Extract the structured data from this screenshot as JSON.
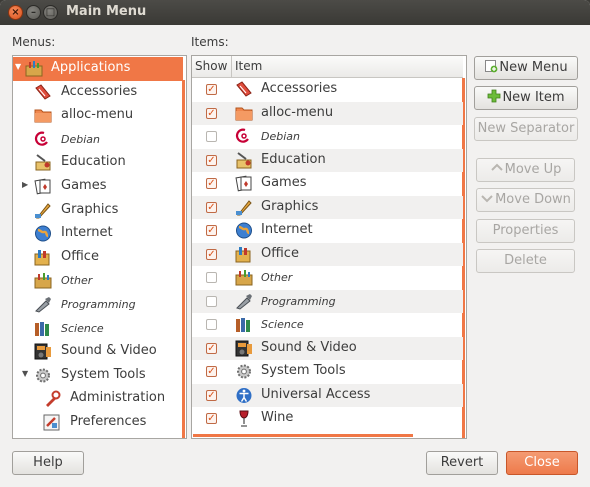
{
  "window": {
    "title": "Main Menu"
  },
  "labels": {
    "menus": "Menus:",
    "items": "Items:"
  },
  "columns": {
    "show": "Show",
    "item": "Item"
  },
  "menus": [
    {
      "label": "Applications",
      "icon": "applications-icon",
      "selected": true,
      "indent": 0,
      "expanded": true
    },
    {
      "label": "Accessories",
      "icon": "accessories-icon",
      "indent": 1
    },
    {
      "label": "alloc-menu",
      "icon": "folder-icon",
      "indent": 1
    },
    {
      "label": "Debian",
      "icon": "debian-icon",
      "indent": 1,
      "italic": true
    },
    {
      "label": "Education",
      "icon": "education-icon",
      "indent": 1
    },
    {
      "label": "Games",
      "icon": "games-icon",
      "indent": 1,
      "collapsed": true
    },
    {
      "label": "Graphics",
      "icon": "graphics-icon",
      "indent": 1
    },
    {
      "label": "Internet",
      "icon": "internet-icon",
      "indent": 1
    },
    {
      "label": "Office",
      "icon": "office-icon",
      "indent": 1
    },
    {
      "label": "Other",
      "icon": "other-icon",
      "indent": 1,
      "italic": true
    },
    {
      "label": "Programming",
      "icon": "programming-icon",
      "indent": 1,
      "italic": true
    },
    {
      "label": "Science",
      "icon": "science-icon",
      "indent": 1,
      "italic": true
    },
    {
      "label": "Sound & Video",
      "icon": "sound-video-icon",
      "indent": 1
    },
    {
      "label": "System Tools",
      "icon": "system-tools-icon",
      "indent": 1,
      "expanded": true
    },
    {
      "label": "Administration",
      "icon": "administration-icon",
      "indent": 2
    },
    {
      "label": "Preferences",
      "icon": "preferences-icon",
      "indent": 2
    }
  ],
  "items": [
    {
      "label": "Accessories",
      "icon": "accessories-icon",
      "show": true
    },
    {
      "label": "alloc-menu",
      "icon": "folder-icon",
      "show": true
    },
    {
      "label": "Debian",
      "icon": "debian-icon",
      "show": false,
      "italic": true
    },
    {
      "label": "Education",
      "icon": "education-icon",
      "show": true
    },
    {
      "label": "Games",
      "icon": "games-icon",
      "show": true
    },
    {
      "label": "Graphics",
      "icon": "graphics-icon",
      "show": true
    },
    {
      "label": "Internet",
      "icon": "internet-icon",
      "show": true
    },
    {
      "label": "Office",
      "icon": "office-icon",
      "show": true
    },
    {
      "label": "Other",
      "icon": "other-icon",
      "show": false,
      "italic": true
    },
    {
      "label": "Programming",
      "icon": "programming-icon",
      "show": false,
      "italic": true
    },
    {
      "label": "Science",
      "icon": "science-icon",
      "show": false,
      "italic": true
    },
    {
      "label": "Sound & Video",
      "icon": "sound-video-icon",
      "show": true
    },
    {
      "label": "System Tools",
      "icon": "system-tools-icon",
      "show": true
    },
    {
      "label": "Universal Access",
      "icon": "universal-access-icon",
      "show": true
    },
    {
      "label": "Wine",
      "icon": "wine-icon",
      "show": true
    }
  ],
  "buttons": {
    "new_menu": "New Menu",
    "new_item": "New Item",
    "new_separator": "New Separator",
    "move_up": "Move Up",
    "move_down": "Move Down",
    "properties": "Properties",
    "delete": "Delete",
    "help": "Help",
    "revert": "Revert",
    "close": "Close"
  },
  "colors": {
    "accent": "#f07746",
    "titlebar": "#3c3b37",
    "background": "#f2f1f0"
  }
}
